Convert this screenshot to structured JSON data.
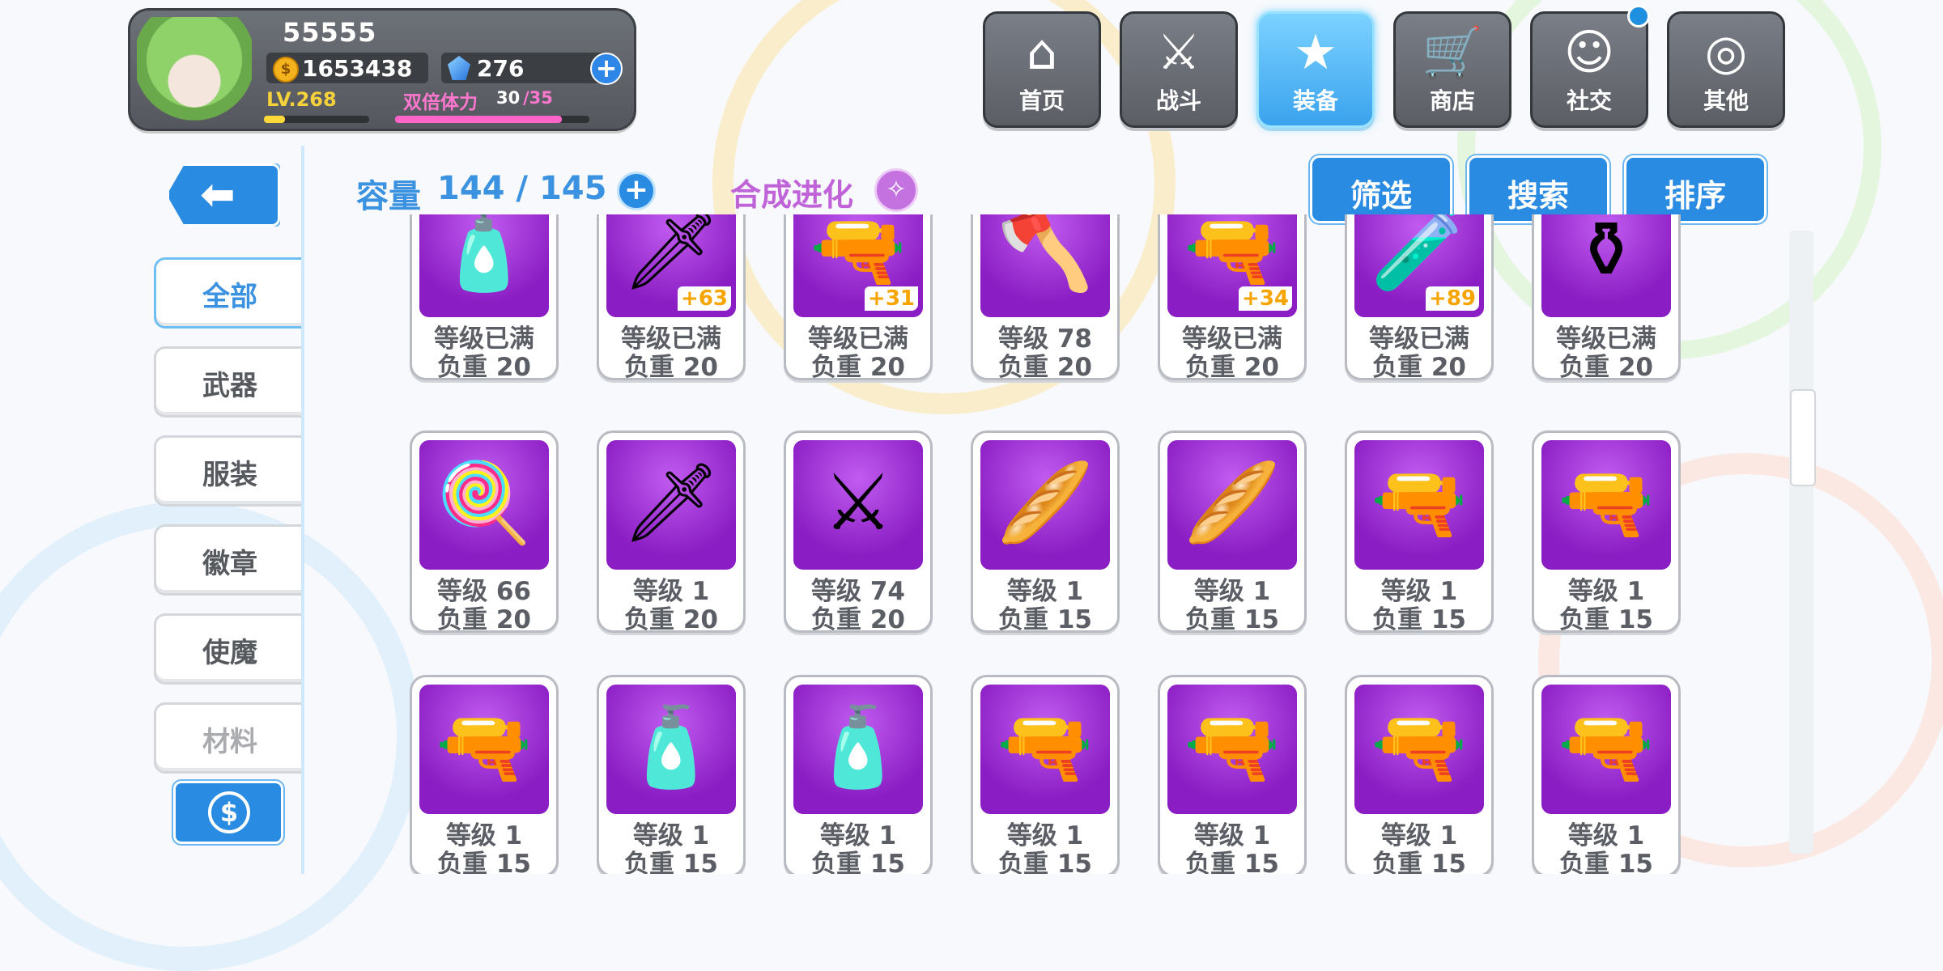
{
  "player": {
    "name": "55555",
    "gold": "1653438",
    "gems": "276",
    "level": "LV.268",
    "level_progress": 0.2,
    "stamina_label": "双倍体力",
    "stamina_current": "30",
    "stamina_max": "/35",
    "stamina_progress": 0.86
  },
  "nav": [
    {
      "label": "首页",
      "icon": "home-icon",
      "glyph": "⌂"
    },
    {
      "label": "战斗",
      "icon": "crossed-guns-icon",
      "glyph": "⚔"
    },
    {
      "label": "装备",
      "icon": "star-gun-icon",
      "glyph": "★"
    },
    {
      "label": "商店",
      "icon": "shop-basket-icon",
      "glyph": "🛒"
    },
    {
      "label": "社交",
      "icon": "social-icon",
      "glyph": "☺"
    },
    {
      "label": "其他",
      "icon": "target-icon",
      "glyph": "◎"
    }
  ],
  "sidebar": {
    "tabs": [
      {
        "label": "全部"
      },
      {
        "label": "武器"
      },
      {
        "label": "服装"
      },
      {
        "label": "徽章"
      },
      {
        "label": "使魔"
      },
      {
        "label": "材料"
      }
    ]
  },
  "header": {
    "capacity_label": "容量",
    "capacity_value": "144 / 145",
    "synthesis_label": "合成进化",
    "filter_label": "筛选",
    "search_label": "搜索",
    "sort_label": "排序"
  },
  "scroll_position": 0.3,
  "items": [
    {
      "glyph": "🧴",
      "level": "等级已满",
      "weight": "负重 20",
      "plus": "",
      "icon": "potion-bottle-icon"
    },
    {
      "glyph": "🗡",
      "level": "等级已满",
      "weight": "负重 20",
      "plus": "+63",
      "icon": "sword-icon"
    },
    {
      "glyph": "🔫",
      "level": "等级已满",
      "weight": "负重 20",
      "plus": "+31",
      "icon": "green-gun-icon"
    },
    {
      "glyph": "🪓",
      "level": "等级 78",
      "weight": "负重 20",
      "plus": "",
      "icon": "red-axe-icon"
    },
    {
      "glyph": "🔫",
      "level": "等级已满",
      "weight": "负重 20",
      "plus": "+34",
      "icon": "musket-icon"
    },
    {
      "glyph": "🧪",
      "level": "等级已满",
      "weight": "负重 20",
      "plus": "+89",
      "icon": "perfume-bottle-icon"
    },
    {
      "glyph": "⚱",
      "level": "等级已满",
      "weight": "负重 20",
      "plus": "",
      "icon": "black-vase-icon"
    },
    {
      "glyph": "🍭",
      "level": "等级 66",
      "weight": "负重 20",
      "plus": "",
      "icon": "pink-wand-icon"
    },
    {
      "glyph": "🗡",
      "level": "等级 1",
      "weight": "负重 20",
      "plus": "",
      "icon": "dark-blade-icon"
    },
    {
      "glyph": "⚔",
      "level": "等级 74",
      "weight": "负重 20",
      "plus": "",
      "icon": "chain-sword-icon"
    },
    {
      "glyph": "🥖",
      "level": "等级 1",
      "weight": "负重 15",
      "plus": "",
      "icon": "baguette-icon"
    },
    {
      "glyph": "🥖",
      "level": "等级 1",
      "weight": "负重 15",
      "plus": "",
      "icon": "baguette-icon"
    },
    {
      "glyph": "🔫",
      "level": "等级 1",
      "weight": "负重 15",
      "plus": "",
      "icon": "sofa-gun-icon"
    },
    {
      "glyph": "🔫",
      "level": "等级 1",
      "weight": "负重 15",
      "plus": "",
      "icon": "rifle-icon"
    },
    {
      "glyph": "🔫",
      "level": "等级 1",
      "weight": "负重 15",
      "plus": "",
      "icon": "rifle-icon"
    },
    {
      "glyph": "🧴",
      "level": "等级 1",
      "weight": "负重 15",
      "plus": "",
      "icon": "perfume-bottle-icon"
    },
    {
      "glyph": "🧴",
      "level": "等级 1",
      "weight": "负重 15",
      "plus": "",
      "icon": "potion-bottle-icon"
    },
    {
      "glyph": "🔫",
      "level": "等级 1",
      "weight": "负重 15",
      "plus": "",
      "icon": "green-gun-icon"
    },
    {
      "glyph": "🔫",
      "level": "等级 1",
      "weight": "负重 15",
      "plus": "",
      "icon": "green-gun-icon"
    },
    {
      "glyph": "🔫",
      "level": "等级 1",
      "weight": "负重 15",
      "plus": "",
      "icon": "musket-icon"
    },
    {
      "glyph": "🔫",
      "level": "等级 1",
      "weight": "负重 15",
      "plus": "",
      "icon": "musket-icon"
    }
  ],
  "colors": {
    "accent": "#2a8be2",
    "item_bg": "#a13ed8",
    "plus_badge": "#f6a400"
  }
}
